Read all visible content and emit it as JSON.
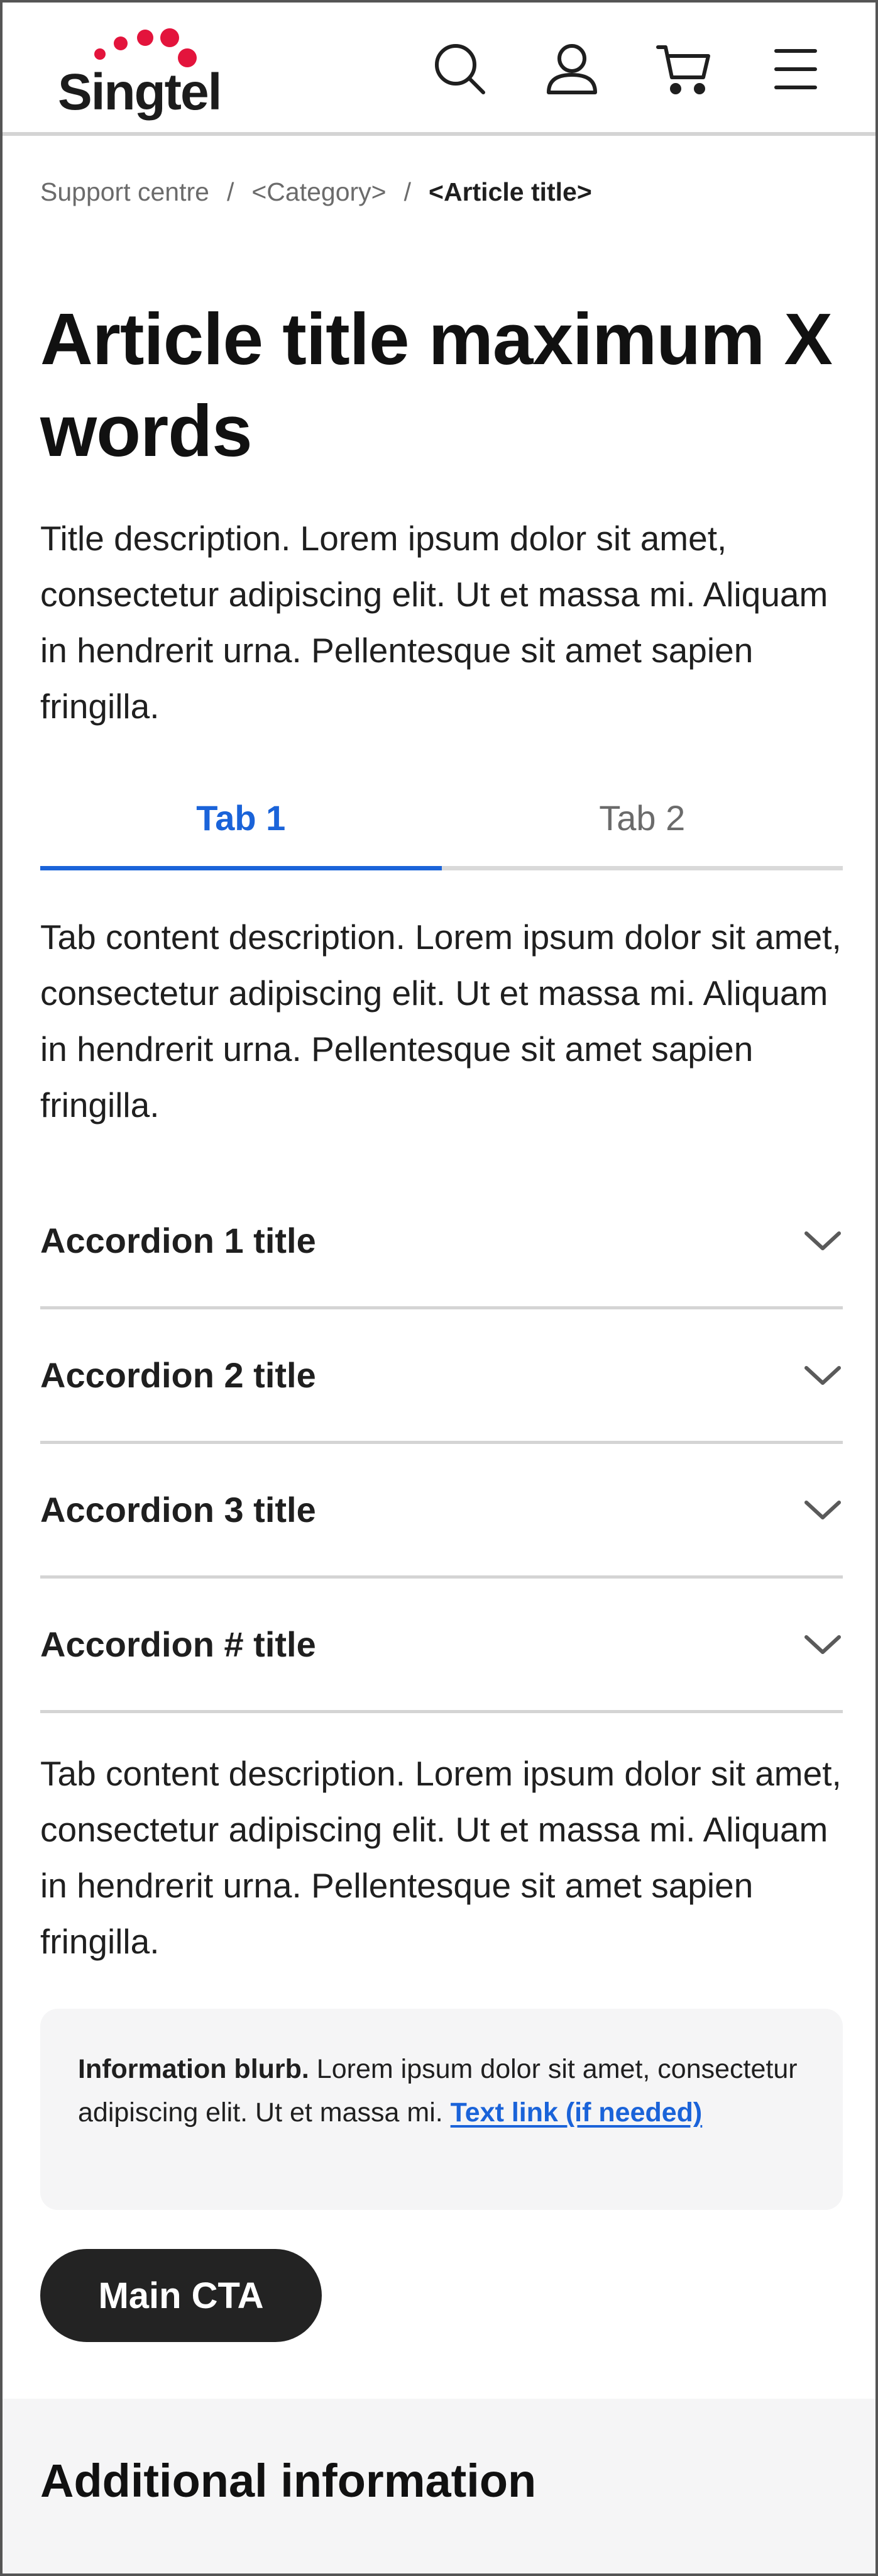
{
  "header": {
    "logo_text": "Singtel",
    "brand_color": "#e3143c",
    "icons": [
      "search-icon",
      "user-icon",
      "cart-icon",
      "menu-icon"
    ]
  },
  "breadcrumb": {
    "items": [
      "Support centre",
      "<Category>"
    ],
    "separator": "/",
    "current": "<Article title>"
  },
  "article": {
    "title": "Article title maximum X words",
    "description": "Title description. Lorem ipsum dolor sit amet, consectetur adipiscing elit. Ut et massa mi. Aliquam in hendrerit urna. Pellentesque sit amet sapien fringilla."
  },
  "tabs": [
    {
      "label": "Tab 1",
      "active": true
    },
    {
      "label": "Tab 2",
      "active": false
    }
  ],
  "tab_content": {
    "description_top": "Tab content description. Lorem ipsum dolor sit amet, consectetur adipiscing elit. Ut et massa mi. Aliquam in hendrerit urna. Pellentesque sit amet sapien fringilla.",
    "description_bottom": "Tab content description. Lorem ipsum dolor sit amet, consectetur adipiscing elit. Ut et massa mi. Aliquam in hendrerit urna. Pellentesque sit amet sapien fringilla."
  },
  "accordions": [
    {
      "title": "Accordion 1 title"
    },
    {
      "title": "Accordion 2 title"
    },
    {
      "title": "Accordion 3 title"
    },
    {
      "title": "Accordion # title"
    }
  ],
  "info_blurb": {
    "bold": "Information blurb.",
    "text": " Lorem ipsum dolor sit amet, consectetur adipiscing elit. Ut et massa mi. ",
    "link": "Text link (if needed)"
  },
  "cta": {
    "label": "Main CTA"
  },
  "additional": {
    "title": "Additional information"
  },
  "colors": {
    "accent": "#1a63d9",
    "cta_bg": "#232323",
    "panel_bg": "#f5f5f6"
  }
}
